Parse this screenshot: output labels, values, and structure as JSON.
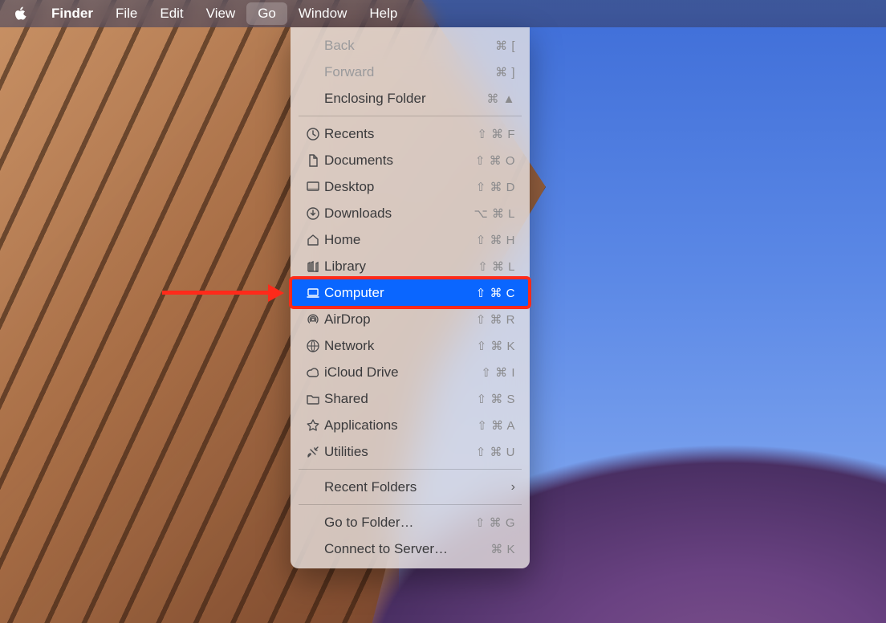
{
  "menubar": {
    "app": "Finder",
    "items": [
      "File",
      "Edit",
      "View",
      "Go",
      "Window",
      "Help"
    ],
    "open_index": 3
  },
  "dropdown": {
    "sections": [
      [
        {
          "id": "back",
          "label": "Back",
          "shortcut": "⌘ [",
          "disabled": true
        },
        {
          "id": "forward",
          "label": "Forward",
          "shortcut": "⌘ ]",
          "disabled": true
        },
        {
          "id": "enclosing",
          "label": "Enclosing Folder",
          "shortcut": "⌘ ▲"
        }
      ],
      [
        {
          "id": "recents",
          "label": "Recents",
          "shortcut": "⇧ ⌘ F",
          "icon": "clock-icon"
        },
        {
          "id": "documents",
          "label": "Documents",
          "shortcut": "⇧ ⌘ O",
          "icon": "document-icon"
        },
        {
          "id": "desktop",
          "label": "Desktop",
          "shortcut": "⇧ ⌘ D",
          "icon": "desktop-icon"
        },
        {
          "id": "downloads",
          "label": "Downloads",
          "shortcut": "⌥ ⌘ L",
          "icon": "downloads-icon"
        },
        {
          "id": "home",
          "label": "Home",
          "shortcut": "⇧ ⌘ H",
          "icon": "home-icon"
        },
        {
          "id": "library",
          "label": "Library",
          "shortcut": "⇧ ⌘ L",
          "icon": "library-icon"
        },
        {
          "id": "computer",
          "label": "Computer",
          "shortcut": "⇧ ⌘ C",
          "icon": "computer-icon",
          "selected": true
        },
        {
          "id": "airdrop",
          "label": "AirDrop",
          "shortcut": "⇧ ⌘ R",
          "icon": "airdrop-icon"
        },
        {
          "id": "network",
          "label": "Network",
          "shortcut": "⇧ ⌘ K",
          "icon": "network-icon"
        },
        {
          "id": "icloud",
          "label": "iCloud Drive",
          "shortcut": "⇧ ⌘ I",
          "icon": "cloud-icon"
        },
        {
          "id": "shared",
          "label": "Shared",
          "shortcut": "⇧ ⌘ S",
          "icon": "folder-icon"
        },
        {
          "id": "applications",
          "label": "Applications",
          "shortcut": "⇧ ⌘ A",
          "icon": "applications-icon"
        },
        {
          "id": "utilities",
          "label": "Utilities",
          "shortcut": "⇧ ⌘ U",
          "icon": "utilities-icon"
        }
      ],
      [
        {
          "id": "recent-folders",
          "label": "Recent Folders",
          "submenu": true
        }
      ],
      [
        {
          "id": "go-to-folder",
          "label": "Go to Folder…",
          "shortcut": "⇧ ⌘ G"
        },
        {
          "id": "connect-to-server",
          "label": "Connect to Server…",
          "shortcut": "⌘ K"
        }
      ]
    ]
  },
  "annotation": {
    "target_id": "computer"
  }
}
